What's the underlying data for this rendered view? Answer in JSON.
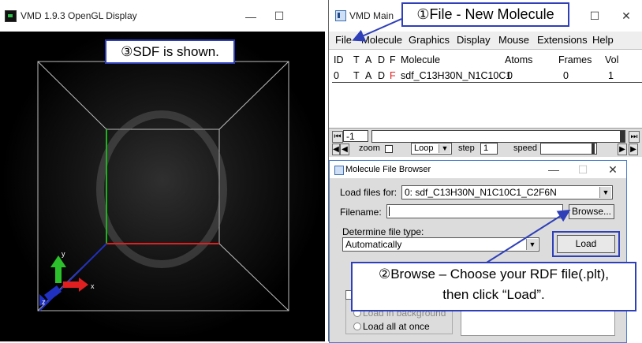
{
  "gl_window": {
    "title": "VMD 1.9.3 OpenGL Display",
    "min_glyph": "—",
    "max_glyph": "☐",
    "axes": {
      "x": "x",
      "y": "y",
      "z": "z"
    }
  },
  "main_window": {
    "title": "VMD Main",
    "min_glyph": "—",
    "max_glyph": "☐",
    "close_glyph": "✕",
    "menu": [
      "File",
      "Molecule",
      "Graphics",
      "Display",
      "Mouse",
      "Extensions",
      "Help"
    ],
    "columns": [
      "ID",
      "T",
      "A",
      "D",
      "F",
      "Molecule",
      "Atoms",
      "Frames",
      "Vol"
    ],
    "rows": [
      {
        "id": "0",
        "t": "T",
        "a": "A",
        "d": "D",
        "f": "F",
        "molecule": "sdf_C13H30N_N1C10C1",
        "atoms": "0",
        "frames": "0",
        "vol": "1"
      }
    ],
    "frame_value": "-1",
    "zoom_label": "zoom",
    "loop_label": "Loop",
    "step_label": "step",
    "step_value": "1",
    "speed_label": "speed"
  },
  "file_browser": {
    "title": "Molecule File Browser",
    "min_glyph": "—",
    "max_glyph": "☐",
    "close_glyph": "✕",
    "load_files_for_label": "Load files for:",
    "load_files_for_value": "0: sdf_C13H30N_N1C10C1_C2F6N",
    "filename_label": "Filename:",
    "filename_value": "",
    "browse_button": "Browse...",
    "determine_type_label": "Determine file type:",
    "file_type_value": "Automatically",
    "load_button": "Load",
    "load_in_background": "Load in background",
    "load_all_at_once": "Load all at once"
  },
  "callouts": {
    "step1": "①File - New Molecule",
    "step2_line1": "②Browse – Choose your RDF file(.plt),",
    "step2_line2": "then click “Load”.",
    "step3": "③SDF is shown."
  },
  "colors": {
    "callout_border": "#2e3fb8",
    "x_axis": "#e02020",
    "y_axis": "#20b020",
    "z_axis": "#2030c0",
    "f_flag": "#e02020"
  }
}
